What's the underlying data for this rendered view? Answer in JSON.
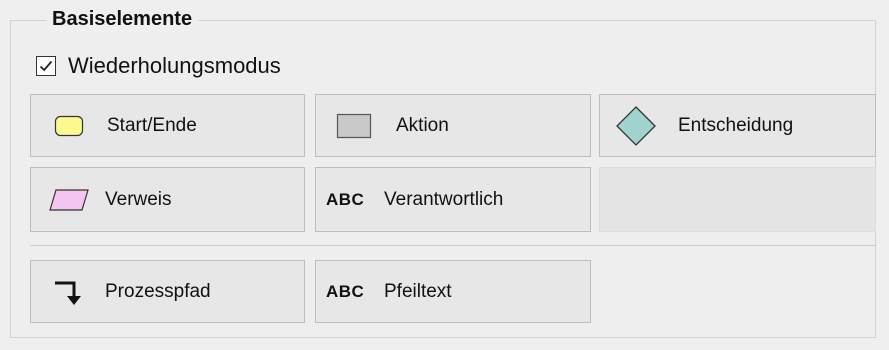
{
  "group": {
    "title": "Basiselemente",
    "checkbox_label": "Wiederholungsmodus",
    "checkbox_checked": true
  },
  "buttons": {
    "start_ende": {
      "label": "Start/Ende",
      "icon": "rounded-rect-icon",
      "color": "#fcf98f"
    },
    "aktion": {
      "label": "Aktion",
      "icon": "rectangle-icon",
      "color": "#c9c9c9"
    },
    "entscheidung": {
      "label": "Entscheidung",
      "icon": "diamond-icon",
      "color": "#9fd4d1"
    },
    "verweis": {
      "label": "Verweis",
      "icon": "parallelogram-icon",
      "color": "#f5c4f1"
    },
    "verantwortlich": {
      "label": "Verantwortlich",
      "icon_text": "ABC"
    },
    "prozesspfad": {
      "label": "Prozesspfad",
      "icon": "bent-arrow-icon"
    },
    "pfeiltext": {
      "label": "Pfeiltext",
      "icon_text": "ABC"
    }
  }
}
